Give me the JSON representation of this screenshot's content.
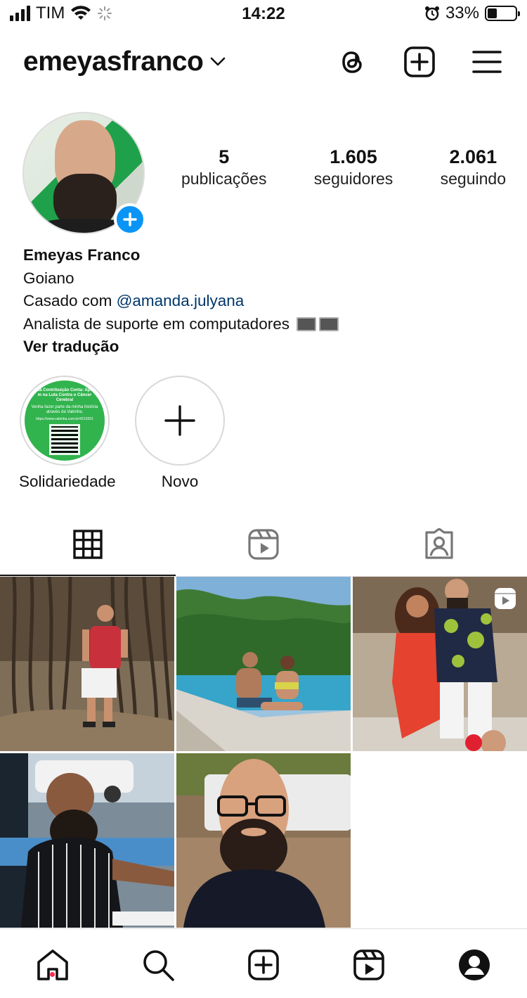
{
  "status_bar": {
    "carrier": "TIM",
    "time": "14:22",
    "battery": "33%"
  },
  "header": {
    "username": "emeyasfranco"
  },
  "profile": {
    "stats": [
      {
        "value": "5",
        "label": "publicações"
      },
      {
        "value": "1.605",
        "label": "seguidores"
      },
      {
        "value": "2.061",
        "label": "seguindo"
      }
    ],
    "name": "Emeyas Franco",
    "bio_line1": "Goiano",
    "bio_line2_prefix": "Casado com ",
    "bio_mention": "@amanda.julyana",
    "bio_line3": "Analista de suporte em computadores",
    "translate_label": "Ver tradução"
  },
  "highlights": [
    {
      "label": "Solidariedade",
      "cover_text": "Cada Contribuição Conta: Apoie-m na Luta Contra o Câncer Cerebral",
      "cover_subtext": "Venha fazer parte da minha história através da Vakinha.",
      "cover_url": "https://www.vakinha.com.br/4210201"
    },
    {
      "label": "Novo"
    }
  ],
  "tabs": [
    {
      "name": "grid",
      "icon": "grid-icon",
      "active": true
    },
    {
      "name": "reels",
      "icon": "reels-icon",
      "active": false
    },
    {
      "name": "tagged",
      "icon": "tagged-icon",
      "active": false
    }
  ],
  "nav": [
    {
      "icon": "home-icon"
    },
    {
      "icon": "search-icon"
    },
    {
      "icon": "create-icon"
    },
    {
      "icon": "reels-icon"
    },
    {
      "icon": "profile-icon"
    }
  ],
  "colors": {
    "accent_blue": "#0a95f6",
    "mention": "#00376b",
    "notification_dot": "#ff2a55"
  }
}
